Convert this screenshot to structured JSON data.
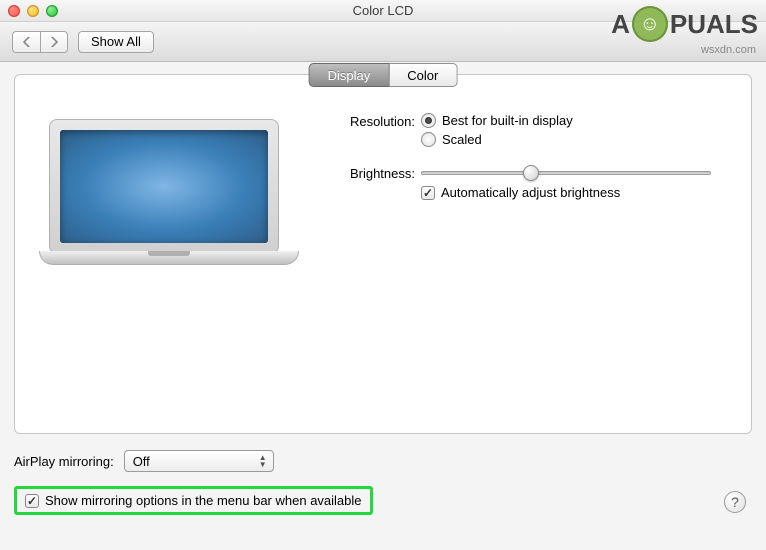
{
  "window": {
    "title": "Color LCD"
  },
  "toolbar": {
    "show_all_label": "Show All"
  },
  "tabs": {
    "display": "Display",
    "color": "Color",
    "selected": "display"
  },
  "resolution": {
    "label": "Resolution:",
    "best": "Best for built-in display",
    "scaled": "Scaled",
    "selected": "best"
  },
  "brightness": {
    "label": "Brightness:",
    "value_percent": 35,
    "auto_label": "Automatically adjust brightness",
    "auto_checked": true
  },
  "airplay": {
    "label": "AirPlay mirroring:",
    "selected": "Off"
  },
  "mirror_menu": {
    "label": "Show mirroring options in the menu bar when available",
    "checked": true
  },
  "watermark": {
    "brand_a": "A",
    "brand_b": "PUALS",
    "domain": "wsxdn.com"
  },
  "help": {
    "glyph": "?"
  }
}
